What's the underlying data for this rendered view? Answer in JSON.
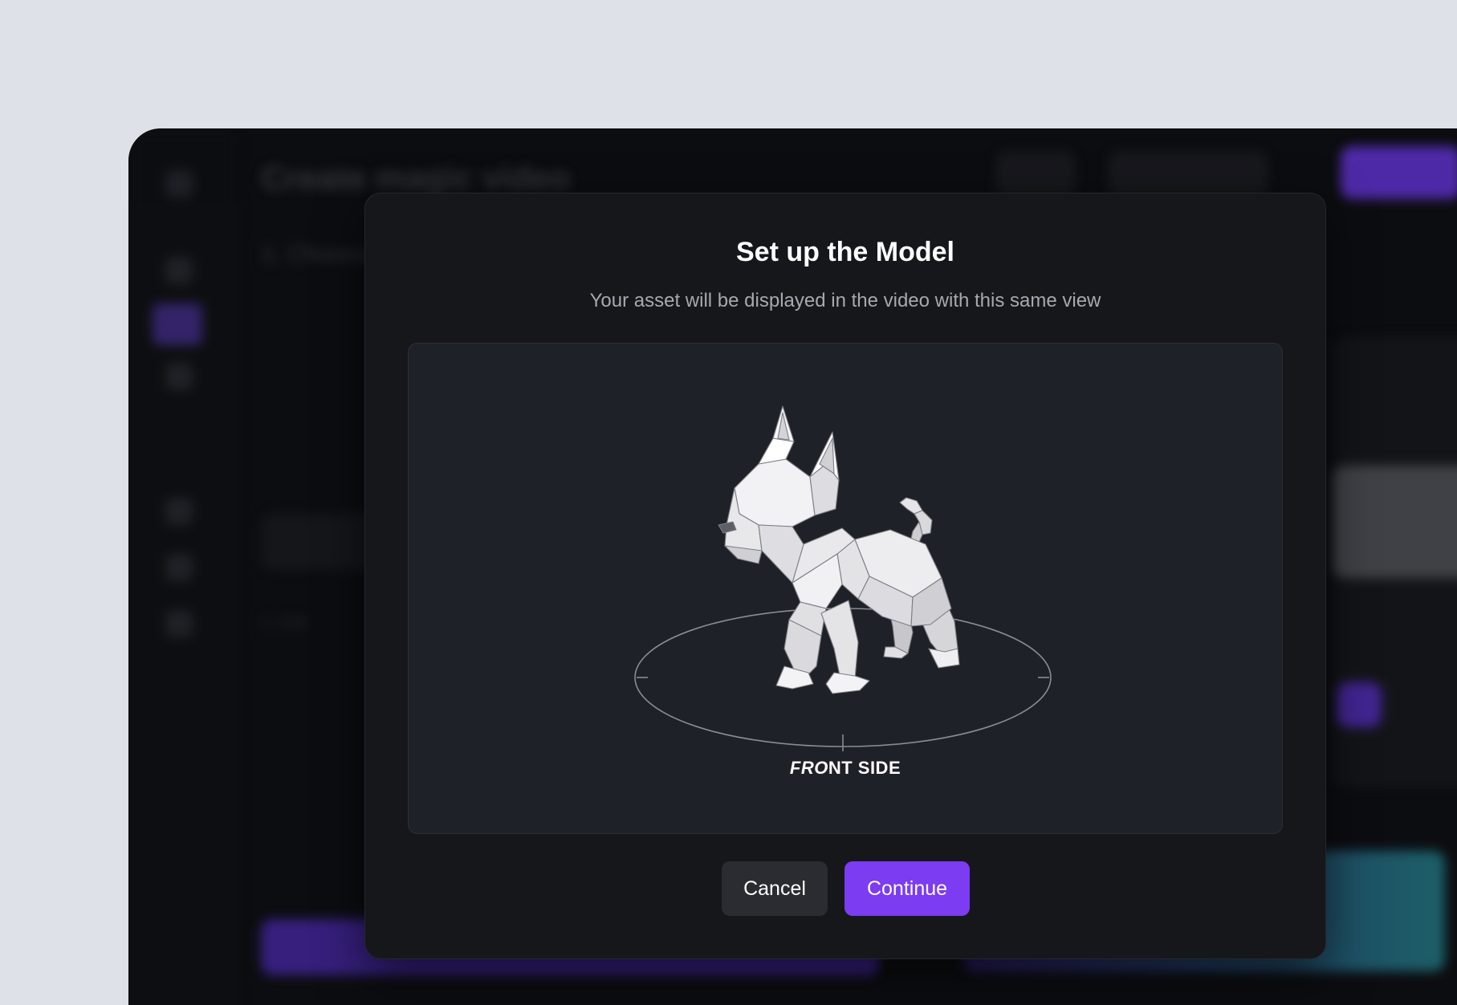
{
  "background_app": {
    "title": "Create magic video",
    "section_heading": "1. Choose",
    "section_heading_2": "2. Add",
    "accent_color": "#5b2fc2"
  },
  "modal": {
    "title": "Set up the Model",
    "subtitle": "Your asset will be displayed in the video with this same view",
    "viewport": {
      "model_icon": "low-poly-dog-model",
      "orientation_label_italic": "FRO",
      "orientation_label_rest": "NT SIDE"
    },
    "cancel_label": "Cancel",
    "continue_label": "Continue",
    "accent_color": "#7b3cf2"
  }
}
